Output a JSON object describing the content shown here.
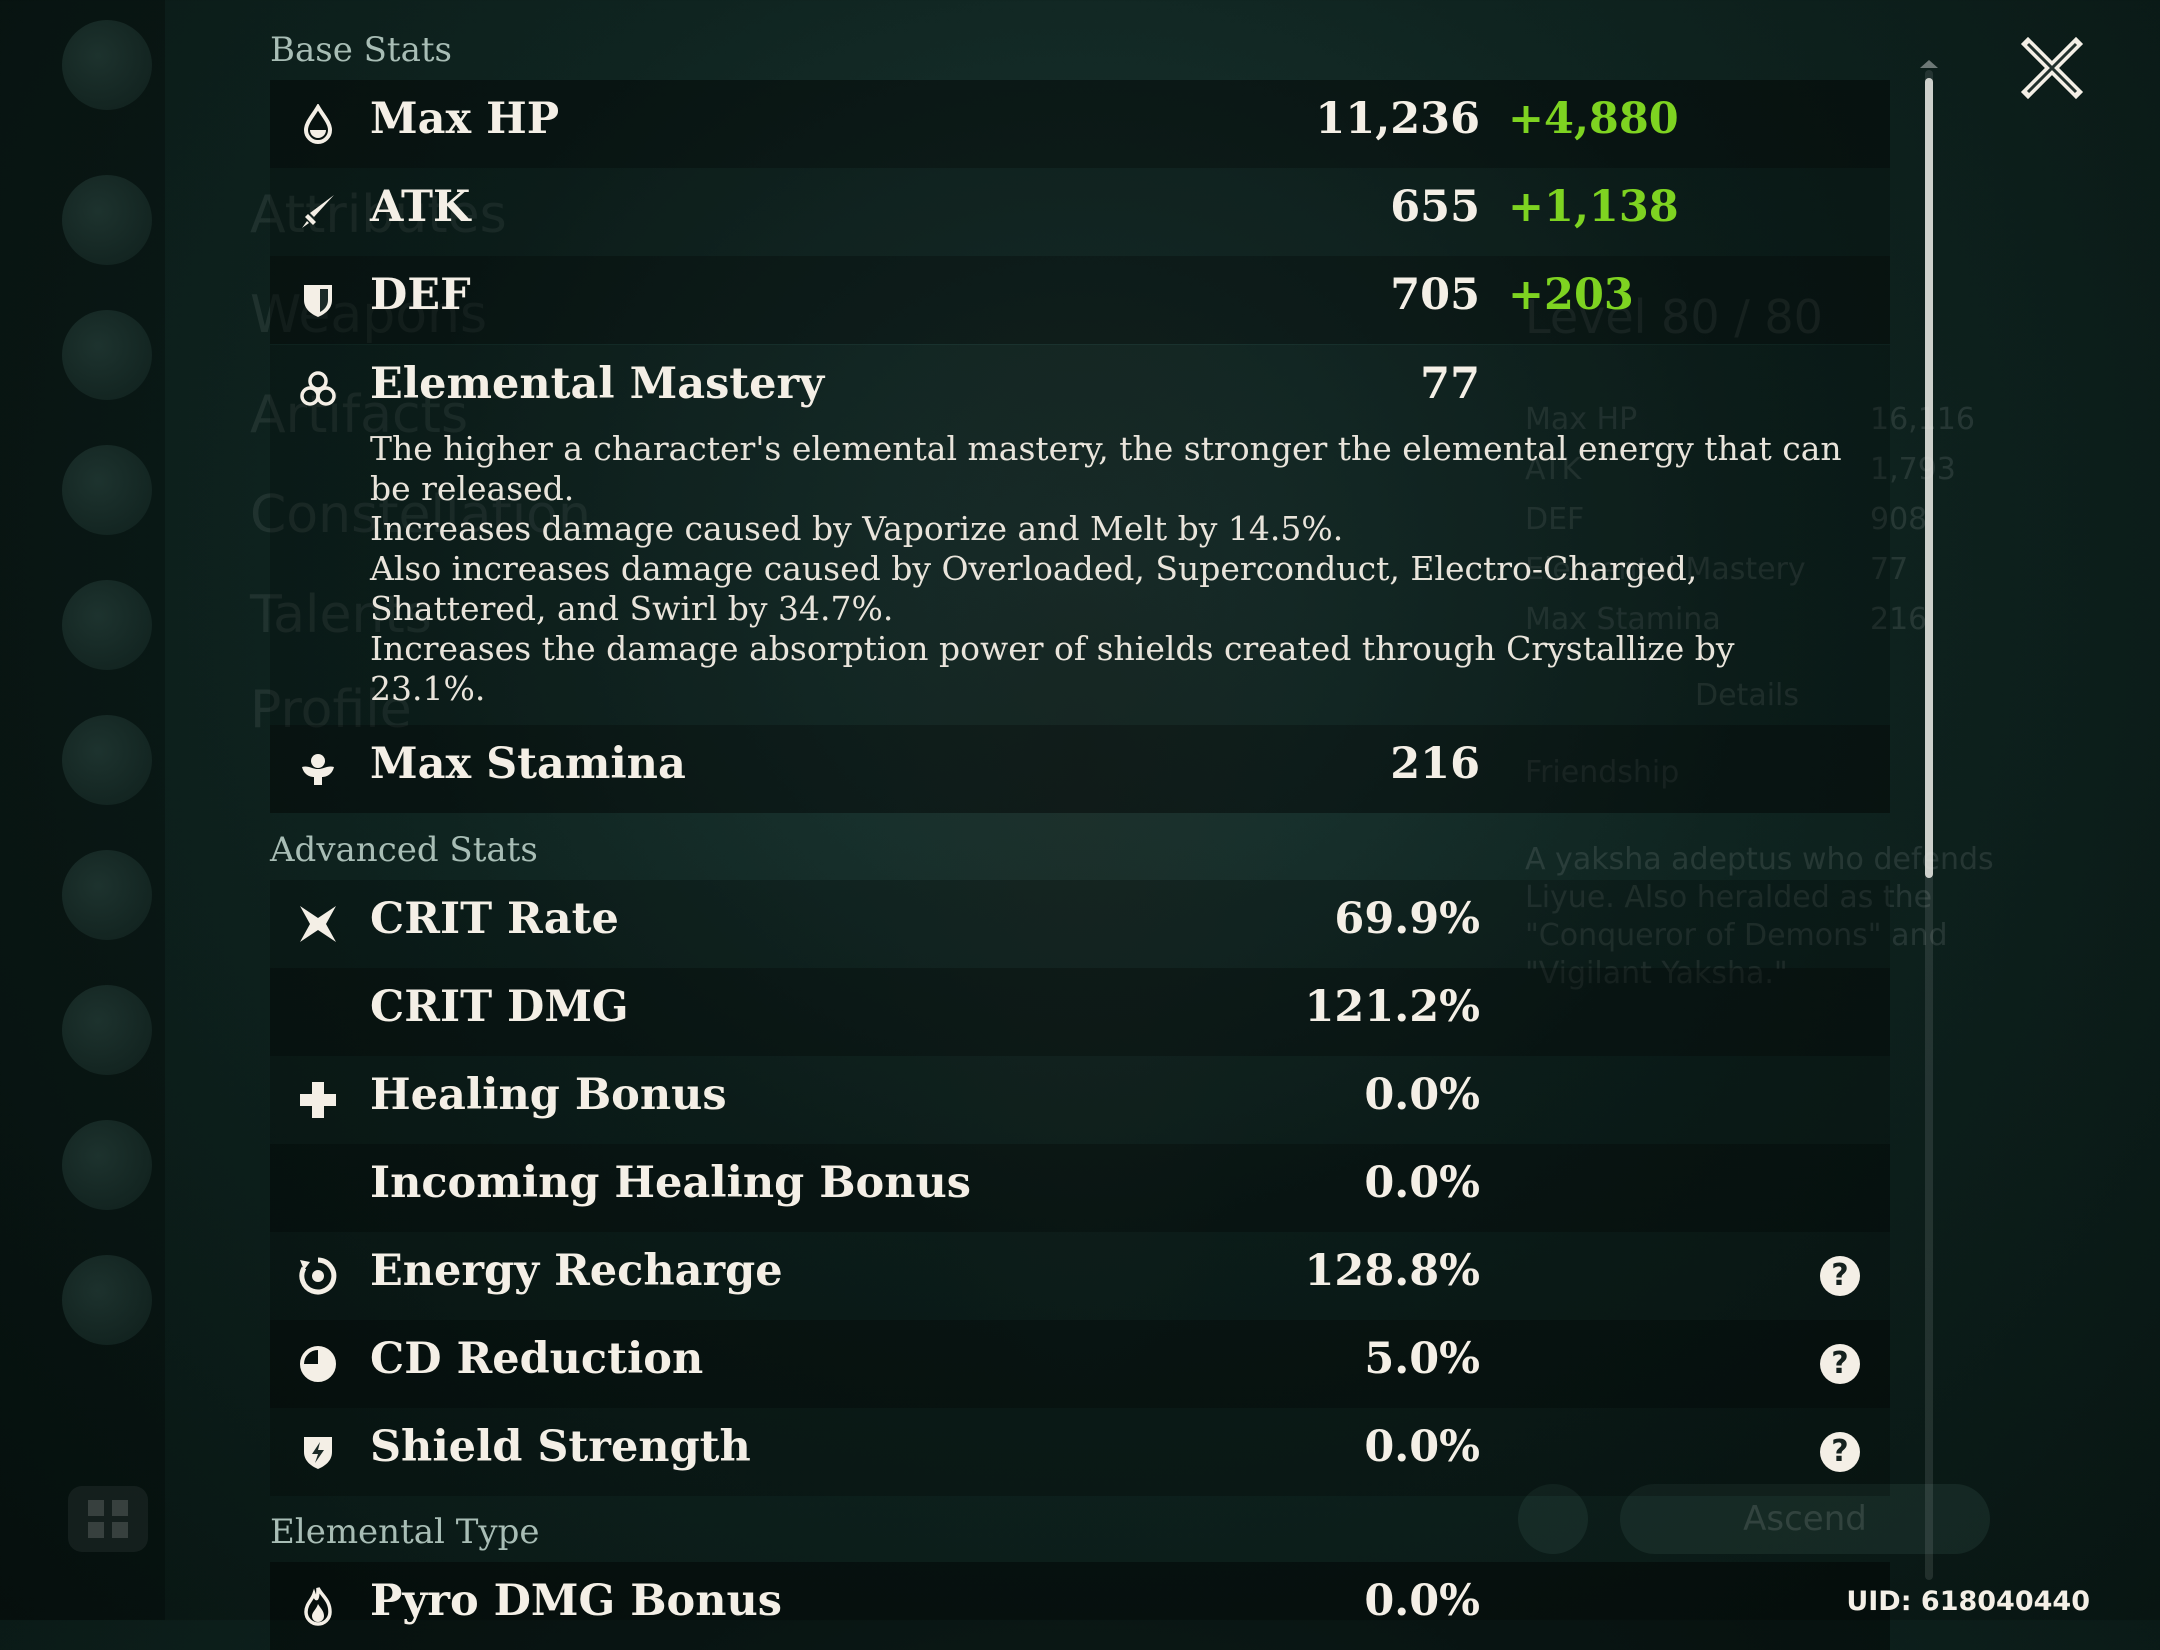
{
  "base_stats": {
    "title": "Base Stats",
    "rows": [
      {
        "label": "Max HP",
        "value": "11,236",
        "bonus": "+4,880",
        "icon": "droplet-icon"
      },
      {
        "label": "ATK",
        "value": "655",
        "bonus": "+1,138",
        "icon": "sword-icon"
      },
      {
        "label": "DEF",
        "value": "705",
        "bonus": "+203",
        "icon": "shield-icon"
      }
    ],
    "elemental_mastery": {
      "label": "Elemental Mastery",
      "value": "77",
      "icon": "elemental-mastery-icon",
      "description": [
        "The higher a character's elemental mastery, the stronger the elemental energy that can",
        "be released.",
        "Increases damage caused by Vaporize and Melt by 14.5%.",
        "Also increases damage caused by Overloaded, Superconduct, Electro-Charged,",
        "Shattered, and Swirl by 34.7%.",
        "Increases the damage absorption power of shields created through Crystallize by",
        "23.1%."
      ]
    },
    "stamina": {
      "label": "Max Stamina",
      "value": "216",
      "icon": "stamina-icon"
    }
  },
  "advanced_stats": {
    "title": "Advanced Stats",
    "rows": [
      {
        "label": "CRIT Rate",
        "value": "69.9%",
        "icon": "crit-icon"
      },
      {
        "label": "CRIT DMG",
        "value": "121.2%"
      },
      {
        "label": "Healing Bonus",
        "value": "0.0%",
        "icon": "cross-icon"
      },
      {
        "label": "Incoming Healing Bonus",
        "value": "0.0%"
      },
      {
        "label": "Energy Recharge",
        "value": "128.8%",
        "icon": "energy-recharge-icon",
        "help": "?"
      },
      {
        "label": "CD Reduction",
        "value": "5.0%",
        "icon": "cd-reduction-icon",
        "help": "?"
      },
      {
        "label": "Shield Strength",
        "value": "0.0%",
        "icon": "shield-strength-icon",
        "help": "?"
      }
    ]
  },
  "elemental_type": {
    "title": "Elemental Type",
    "rows": [
      {
        "label": "Pyro DMG Bonus",
        "value": "0.0%",
        "icon": "pyro-icon"
      }
    ]
  },
  "footer": {
    "uid": "UID: 618040440"
  },
  "background": {
    "menu": [
      "Attributes",
      "Weapons",
      "Artifacts",
      "Constellation",
      "Talents",
      "Profile"
    ],
    "level": "Level 80 / 80",
    "stats": [
      {
        "label": "Max HP",
        "value": "16,116"
      },
      {
        "label": "ATK",
        "value": "1,793"
      },
      {
        "label": "DEF",
        "value": "908"
      },
      {
        "label": "Elemental Mastery",
        "value": "77"
      },
      {
        "label": "Max Stamina",
        "value": "216"
      }
    ],
    "details": "Details",
    "friendship": "Friendship",
    "bio": [
      "A yaksha adeptus who defends",
      "Liyue. Also heralded as the",
      "\"Conqueror of Demons\" and",
      "\"Vigilant Yaksha.\""
    ],
    "ascend": "Ascend"
  },
  "colors": {
    "bonus": "#7ed321",
    "text": "#f4efe6",
    "section": "#a8bdb5"
  }
}
